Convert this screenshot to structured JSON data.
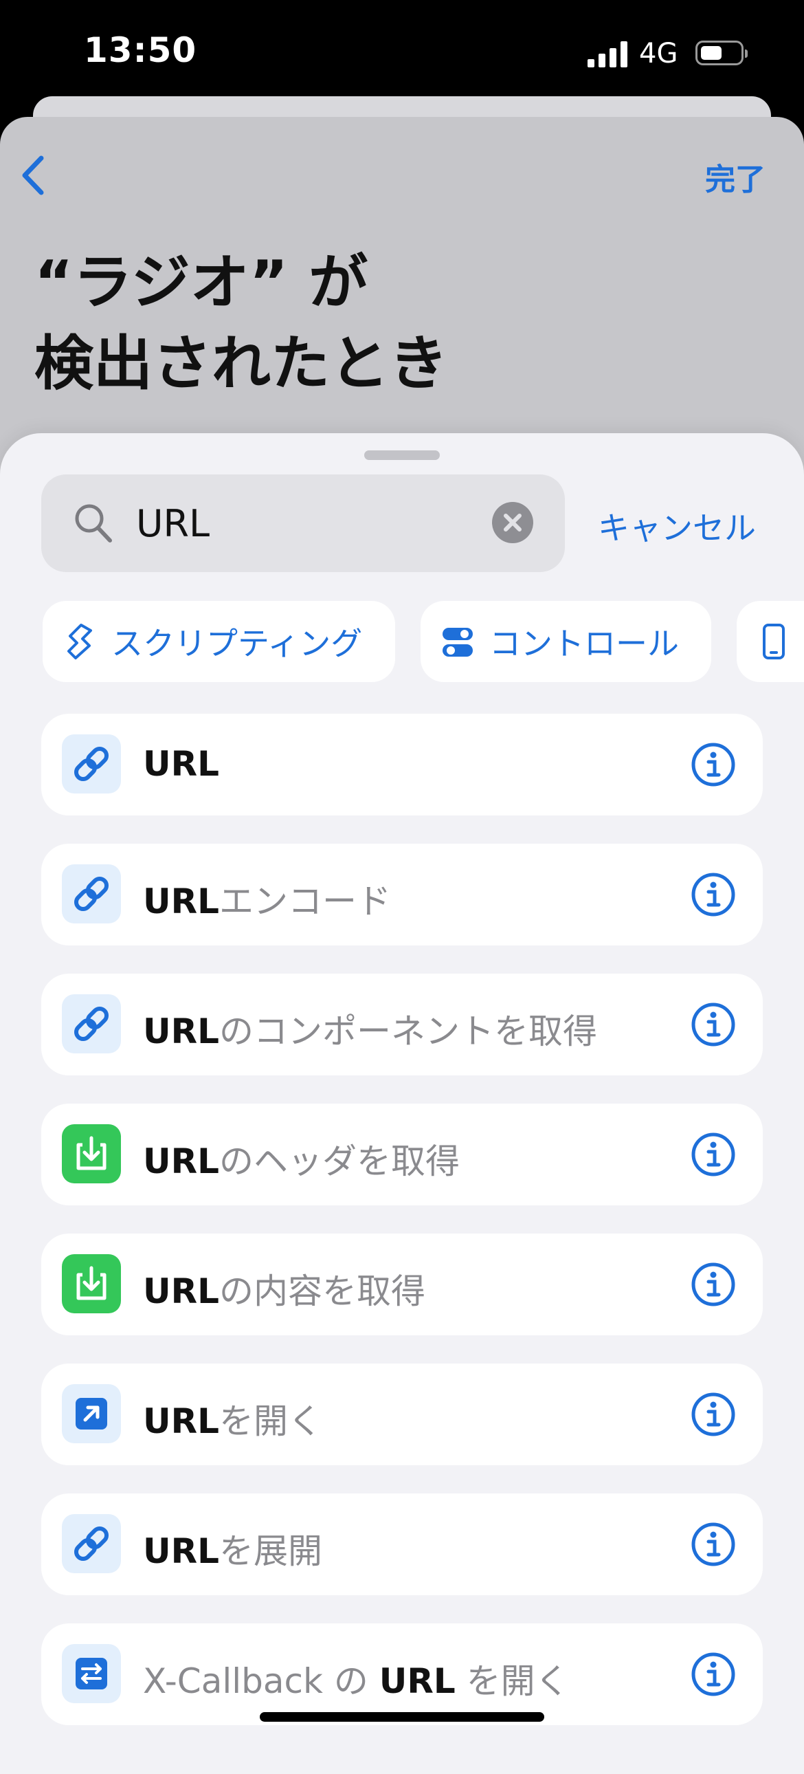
{
  "status_bar": {
    "time": "13:50",
    "network": "4G"
  },
  "nav": {
    "done_label": "完了"
  },
  "page": {
    "title_line1": "“ラジオ” が",
    "title_line2": "検出されたとき"
  },
  "search": {
    "value": "URL",
    "cancel_label": "キャンセル"
  },
  "categories": [
    {
      "label": "スクリプティング",
      "icon": "scripting-icon"
    },
    {
      "label": "コントロール",
      "icon": "toggles-icon"
    },
    {
      "label": "",
      "icon": "device-icon"
    }
  ],
  "actions": [
    {
      "bold": "URL",
      "rest": "",
      "icon": "link-icon"
    },
    {
      "bold": "URL",
      "rest": "エンコード",
      "icon": "link-icon"
    },
    {
      "bold": "URL",
      "rest": "のコンポーネントを取得",
      "icon": "link-icon"
    },
    {
      "bold": "URL",
      "rest": "のヘッダを取得",
      "icon": "download-icon"
    },
    {
      "bold": "URL",
      "rest": "の内容を取得",
      "icon": "download-icon"
    },
    {
      "bold": "URL",
      "rest": "を開く",
      "icon": "open-arrow-icon"
    },
    {
      "bold": "URL",
      "rest": "を展開",
      "icon": "link-icon"
    },
    {
      "pre": "X-Callback の ",
      "bold": "URL",
      "rest": " を開く",
      "icon": "x-callback-icon"
    }
  ],
  "colors": {
    "accent": "#1e6fd9",
    "green": "#34c759",
    "icon_bg": "#e3effc",
    "sheet_bg": "#f2f2f6"
  }
}
